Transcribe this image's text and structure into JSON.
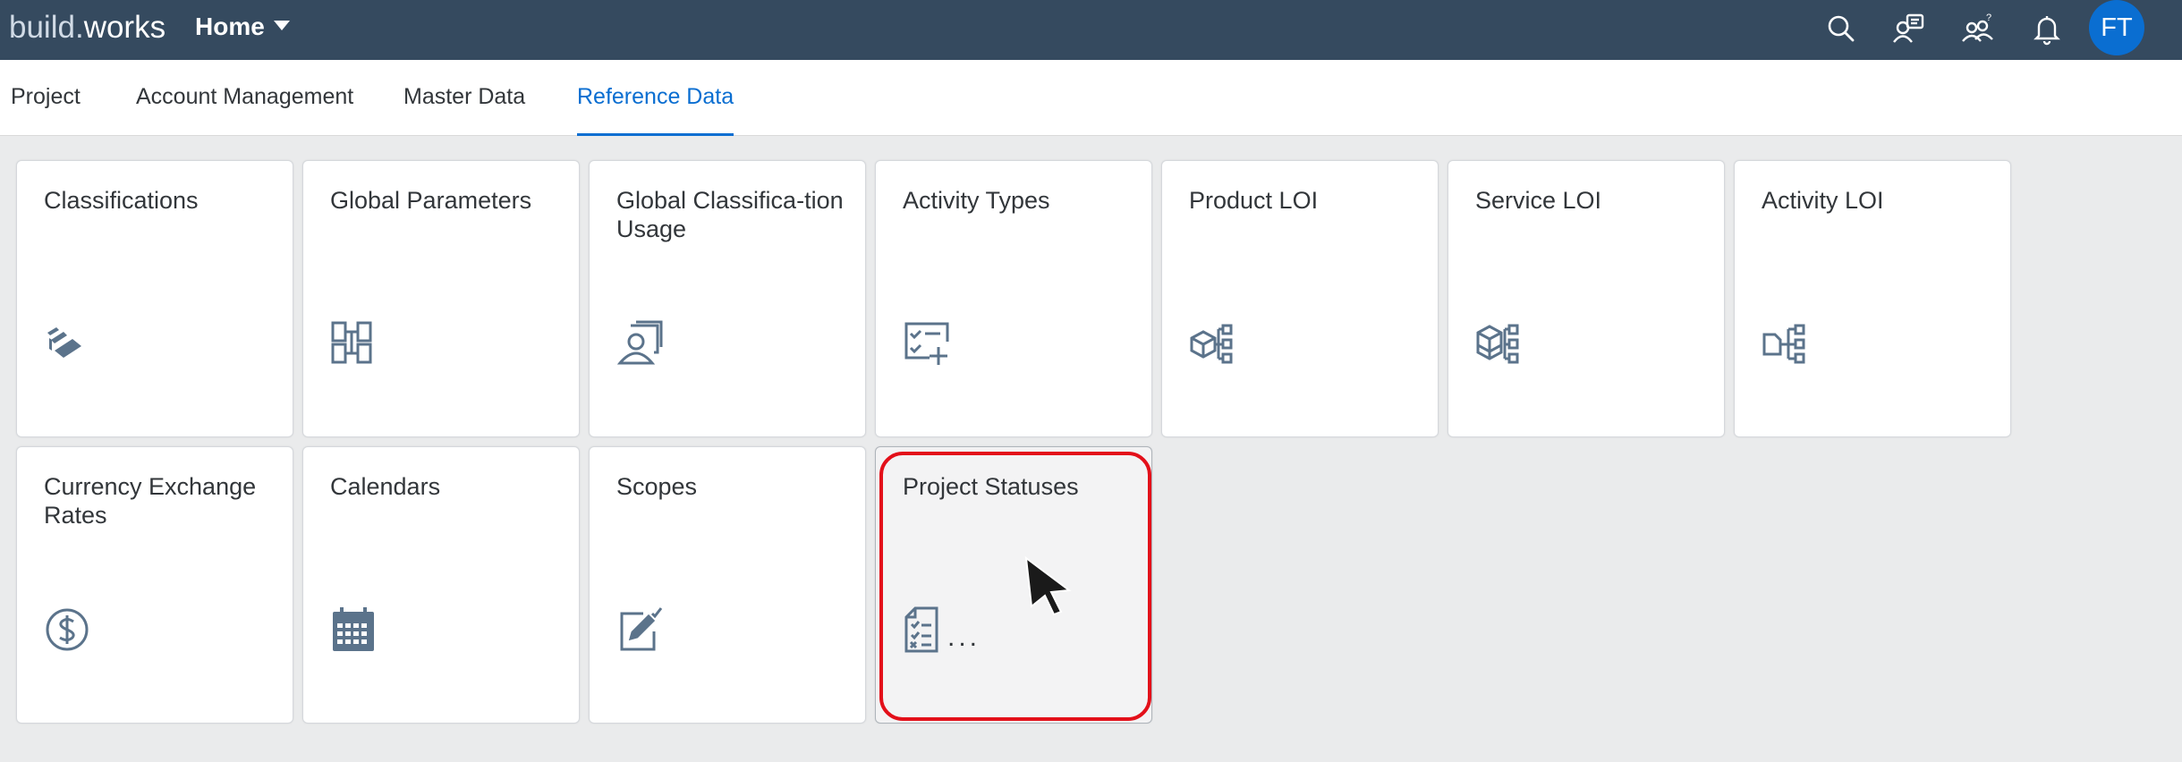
{
  "shell": {
    "brand_main": "build",
    "brand_dot": ".",
    "brand_suffix": "works",
    "home_label": "Home",
    "icons": [
      "search-icon",
      "collaboration-icon",
      "user-group-help-icon",
      "bell-icon"
    ],
    "avatar_initials": "FT",
    "background_color": "#354a5f",
    "avatar_color": "#0a6ed1"
  },
  "tabs": [
    {
      "label": "Project",
      "active": false
    },
    {
      "label": "Account Management",
      "active": false
    },
    {
      "label": "Master Data",
      "active": false
    },
    {
      "label": "Reference Data",
      "active": true
    }
  ],
  "tiles": [
    {
      "title": "Classifications",
      "icon": "classifications-icon"
    },
    {
      "title": "Global Parameters",
      "icon": "global-parameters-icon"
    },
    {
      "title": "Global Classifica-tion Usage",
      "icon": "classification-usage-icon"
    },
    {
      "title": "Activity Types",
      "icon": "activity-types-icon"
    },
    {
      "title": "Product LOI",
      "icon": "product-loi-icon"
    },
    {
      "title": "Service LOI",
      "icon": "service-loi-icon"
    },
    {
      "title": "Activity LOI",
      "icon": "activity-loi-icon"
    },
    {
      "title": "Currency Exchange Rates",
      "icon": "currency-icon"
    },
    {
      "title": "Calendars",
      "icon": "calendar-icon"
    },
    {
      "title": "Scopes",
      "icon": "scopes-icon"
    },
    {
      "title": "Project Statuses",
      "icon": "project-statuses-icon",
      "loading_indicator": "..."
    }
  ],
  "colors": {
    "accent": "#0a6ed1",
    "icon": "#5b738b",
    "highlight": "#e3101a"
  }
}
